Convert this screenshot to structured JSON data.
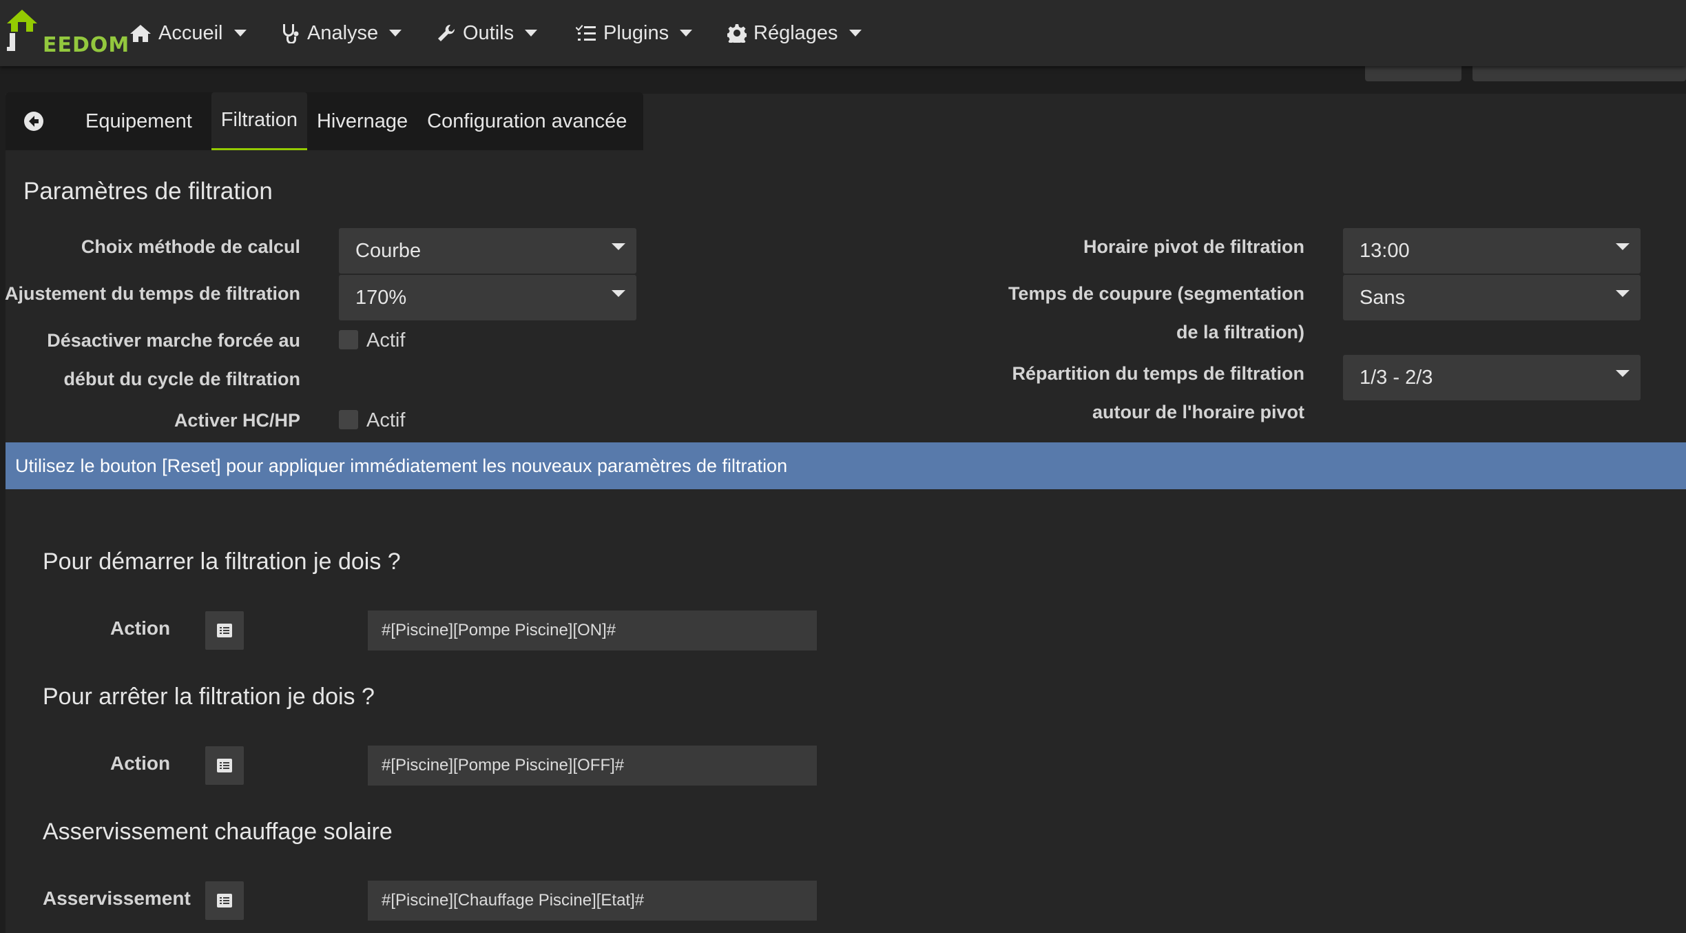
{
  "brand": {
    "logo_text": "EEDOM"
  },
  "navbar": {
    "items": [
      {
        "label": "Accueil",
        "icon": "home-icon"
      },
      {
        "label": "Analyse",
        "icon": "stethoscope-icon"
      },
      {
        "label": "Outils",
        "icon": "wrench-icon"
      },
      {
        "label": "Plugins",
        "icon": "list-check-icon"
      },
      {
        "label": "Réglages",
        "icon": "gear-icon"
      }
    ]
  },
  "tabs": {
    "back_icon": "arrow-circle-left-icon",
    "items": [
      {
        "label": "Equipement"
      },
      {
        "label": "Filtration",
        "active": true
      },
      {
        "label": "Hivernage"
      },
      {
        "label": "Configuration avancée"
      }
    ]
  },
  "filtration": {
    "title": "Paramètres de filtration",
    "methode": {
      "label": "Choix méthode de calcul",
      "value": "Courbe"
    },
    "ajustement": {
      "label": "Ajustement du temps de filtration",
      "value": "170%"
    },
    "desactiver": {
      "label_line1": "Désactiver marche forcée au",
      "label_line2": "début du cycle de filtration",
      "checkbox_label": "Actif",
      "checked": false
    },
    "hchp": {
      "label": "Activer HC/HP",
      "checkbox_label": "Actif",
      "checked": false
    },
    "pivot": {
      "label": "Horaire pivot de filtration",
      "value": "13:00"
    },
    "coupure": {
      "label_line1": "Temps de coupure (segmentation",
      "label_line2": "de la filtration)",
      "value": "Sans"
    },
    "repartition": {
      "label_line1": "Répartition du temps de filtration",
      "label_line2": "autour de l'horaire pivot",
      "value": "1/3 - 2/3"
    }
  },
  "alert": {
    "text": "Utilisez le bouton [Reset] pour appliquer immédiatement les nouveaux paramètres de filtration"
  },
  "demarrer": {
    "title": "Pour démarrer la filtration je dois ?",
    "label": "Action",
    "command": "#[Piscine][Pompe Piscine][ON]#"
  },
  "arreter": {
    "title": "Pour arrêter la filtration je dois ?",
    "label": "Action",
    "command": "#[Piscine][Pompe Piscine][OFF]#"
  },
  "solaire": {
    "title": "Asservissement chauffage solaire",
    "label": "Asservissement",
    "command": "#[Piscine][Chauffage Piscine][Etat]#"
  },
  "colors": {
    "accent": "#94ca02",
    "alert_bg": "#587aab",
    "background": "#1e1e1e"
  }
}
